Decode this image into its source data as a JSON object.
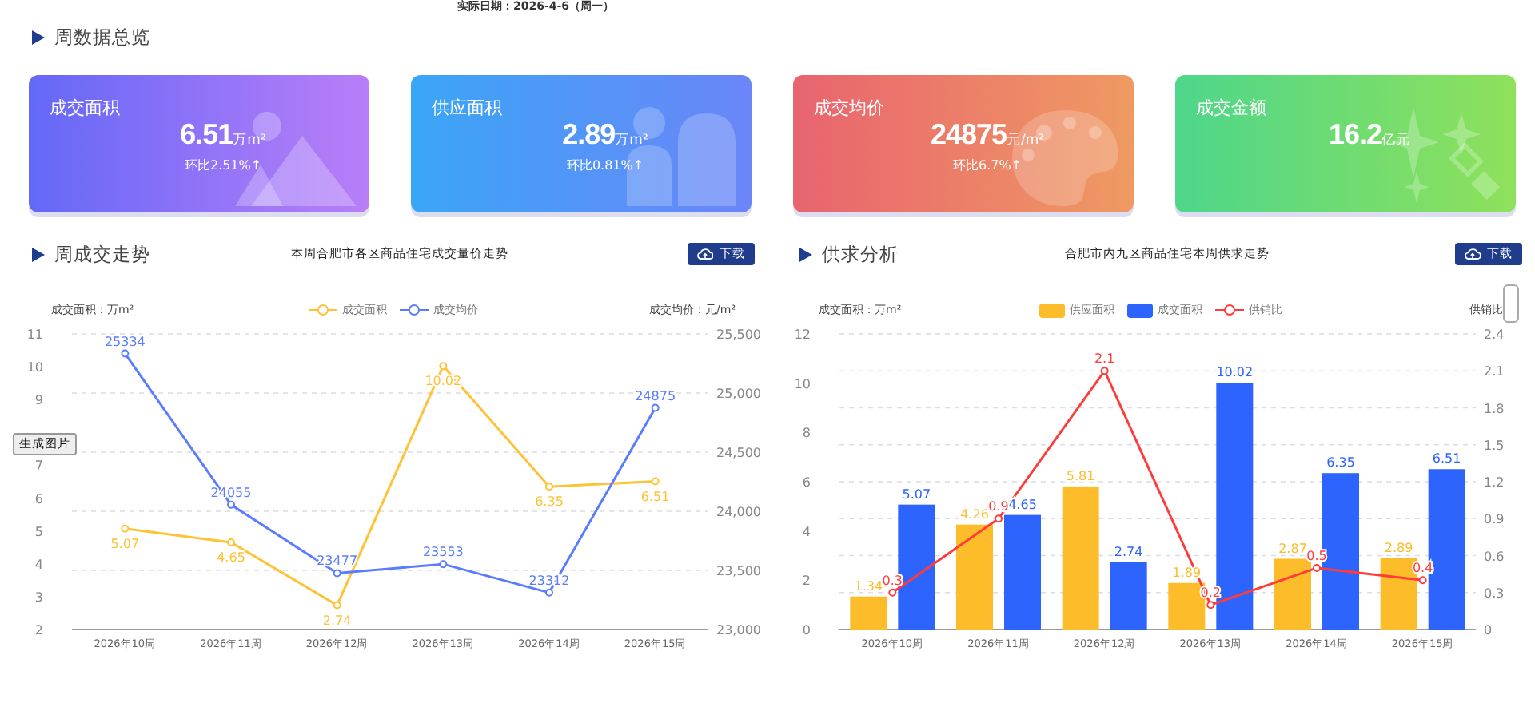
{
  "date_line": "实际日期：2026-4-6（周一）",
  "overview": {
    "heading": "周数据总览",
    "cards": [
      {
        "kind": "mountains",
        "title": "成交面积",
        "value": "6.51",
        "unit": "万m²",
        "change": "环比2.51%↑"
      },
      {
        "kind": "figure",
        "title": "供应面积",
        "value": "2.89",
        "unit": "万m²",
        "change": "环比0.81%↑"
      },
      {
        "kind": "palette",
        "title": "成交均价",
        "value": "24875",
        "unit": "元/m²",
        "change": "环比6.7%↑"
      },
      {
        "kind": "sparkles",
        "title": "成交金额",
        "value": "16.2",
        "unit": "亿元"
      }
    ]
  },
  "sections": [
    {
      "heading": "周成交走势",
      "title": "本周合肥市各区商品住宅成交量价走势",
      "button": "下载",
      "chart_data": {
        "type": "line",
        "ylabel": "成交面积：万m²",
        "y2label": "成交均价：元/m²",
        "grid": true,
        "legend": "top",
        "categories": [
          "2026年10周",
          "2026年11周",
          "2026年12周",
          "2026年13周",
          "2026年14周",
          "2026年15周"
        ],
        "ylim": [
          2,
          11
        ],
        "yticks": [
          2,
          3,
          4,
          5,
          6,
          7,
          9,
          10,
          11
        ],
        "y2lim": [
          23000,
          25500
        ],
        "y2ticks": [
          {
            "value": 23000,
            "label": "23,000"
          },
          {
            "value": 23500,
            "label": "23,500"
          },
          {
            "value": 24000,
            "label": "24,000"
          },
          {
            "value": 24500,
            "label": "24,500"
          },
          {
            "value": 25000,
            "label": "25,000"
          },
          {
            "value": 25500,
            "label": "25,500"
          }
        ],
        "data_labels": true,
        "series": [
          {
            "name": "成交面积",
            "type": "line",
            "marker": "circle",
            "color": "#ffc234",
            "values": [
              5.07,
              4.65,
              2.74,
              10.02,
              6.35,
              6.51
            ]
          },
          {
            "name": "成交均价",
            "type": "line",
            "marker": "circle",
            "axis": "y2",
            "color": "#5a7cff",
            "values": [
              25334,
              24055,
              23477,
              23553,
              23312,
              24875
            ]
          }
        ]
      }
    },
    {
      "heading": "供求分析",
      "title": "合肥市内九区商品住宅本周供求走势",
      "button": "下载",
      "chart_data": {
        "type": "bar",
        "ylabel": "成交面积：万m²",
        "y2label": "供销比",
        "grid": true,
        "legend": "top",
        "categories": [
          "2026年10周",
          "2026年11周",
          "2026年12周",
          "2026年13周",
          "2026年14周",
          "2026年15周"
        ],
        "ylim": [
          0,
          12
        ],
        "yticks": [
          0,
          2,
          4,
          6,
          8,
          10,
          12
        ],
        "y2lim": [
          0,
          2.4
        ],
        "y2ticks": [
          0,
          0.3,
          0.6,
          0.9,
          1.2,
          1.5,
          1.8,
          2.1,
          2.4
        ],
        "data_labels": true,
        "series": [
          {
            "name": "供应面积",
            "type": "bar",
            "color": "#fdbd2a",
            "values": [
              1.34,
              4.26,
              5.81,
              1.89,
              2.87,
              2.89
            ]
          },
          {
            "name": "成交面积",
            "type": "bar",
            "color": "#2e64fe",
            "values": [
              5.07,
              4.65,
              2.74,
              10.02,
              6.35,
              6.51
            ]
          },
          {
            "name": "供销比",
            "type": "line",
            "marker": "circle",
            "axis": "y2",
            "color": "#ff3b3b",
            "values": [
              0.3,
              0.9,
              2.1,
              0.2,
              0.5,
              0.4
            ]
          }
        ]
      }
    }
  ],
  "overlay_button": "生成图片"
}
